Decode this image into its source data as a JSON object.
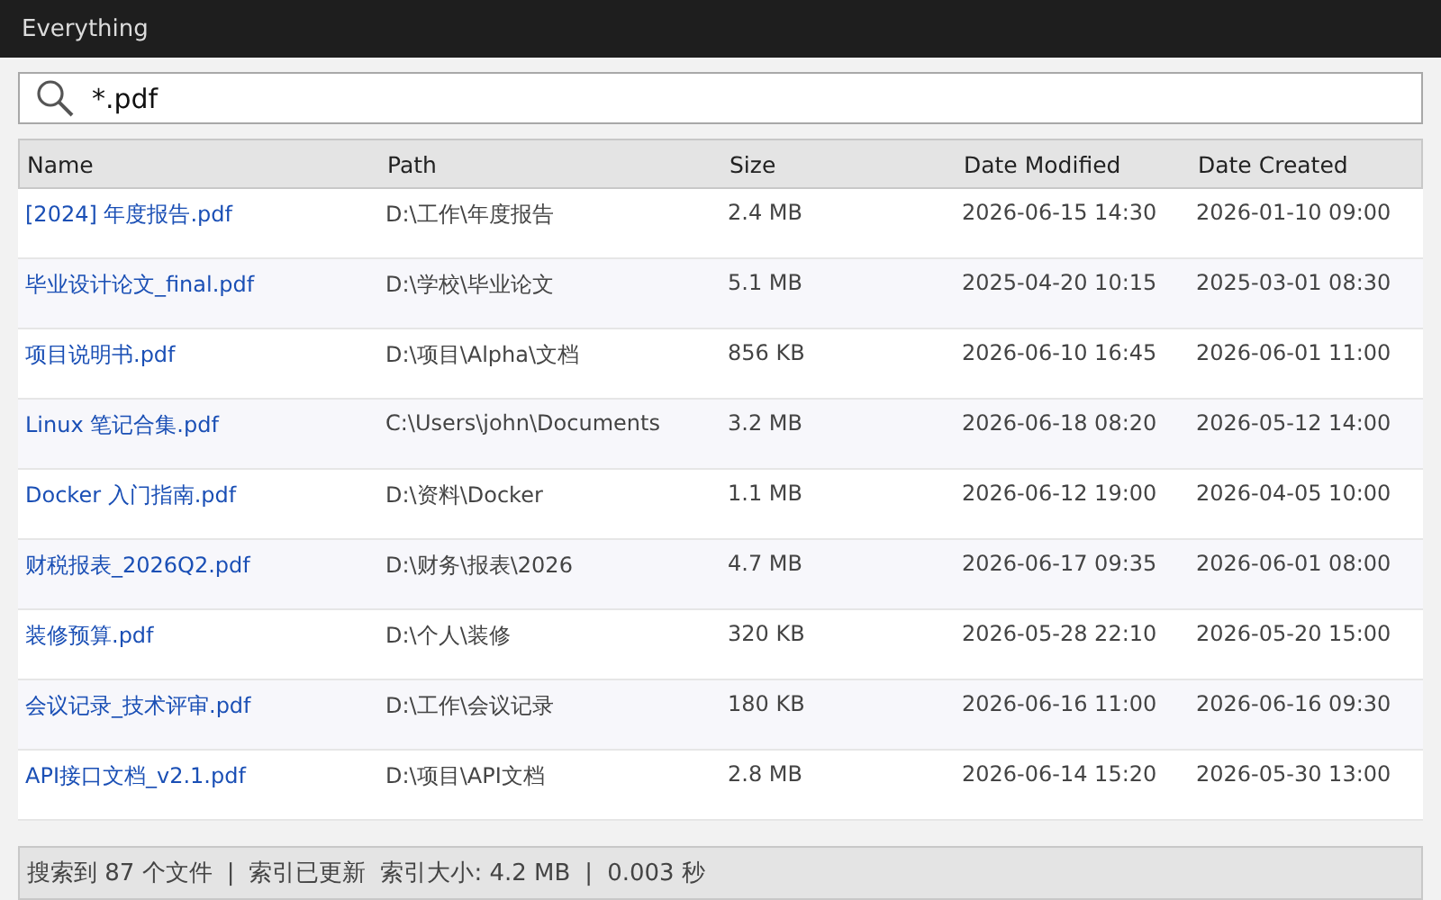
{
  "window": {
    "title": "Everything"
  },
  "search": {
    "value": "*.pdf"
  },
  "table": {
    "columns": [
      "Name",
      "Path",
      "Size",
      "Date Modified",
      "Date Created"
    ],
    "rows": [
      {
        "name": "[2024] 年度报告.pdf",
        "path": "D:\\工作\\年度报告",
        "size": "2.4 MB",
        "modified": "2026-06-15 14:30",
        "created": "2026-01-10 09:00"
      },
      {
        "name": "毕业设计论文_final.pdf",
        "path": "D:\\学校\\毕业论文",
        "size": "5.1 MB",
        "modified": "2025-04-20 10:15",
        "created": "2025-03-01 08:30"
      },
      {
        "name": "项目说明书.pdf",
        "path": "D:\\项目\\Alpha\\文档",
        "size": "856 KB",
        "modified": "2026-06-10 16:45",
        "created": "2026-06-01 11:00"
      },
      {
        "name": "Linux 笔记合集.pdf",
        "path": "C:\\Users\\john\\Documents",
        "size": "3.2 MB",
        "modified": "2026-06-18 08:20",
        "created": "2026-05-12 14:00"
      },
      {
        "name": "Docker 入门指南.pdf",
        "path": "D:\\资料\\Docker",
        "size": "1.1 MB",
        "modified": "2026-06-12 19:00",
        "created": "2026-04-05 10:00"
      },
      {
        "name": "财税报表_2026Q2.pdf",
        "path": "D:\\财务\\报表\\2026",
        "size": "4.7 MB",
        "modified": "2026-06-17 09:35",
        "created": "2026-06-01 08:00"
      },
      {
        "name": "装修预算.pdf",
        "path": "D:\\个人\\装修",
        "size": "320 KB",
        "modified": "2026-05-28 22:10",
        "created": "2026-05-20 15:00"
      },
      {
        "name": "会议记录_技术评审.pdf",
        "path": "D:\\工作\\会议记录",
        "size": "180 KB",
        "modified": "2026-06-16 11:00",
        "created": "2026-06-16 09:30"
      },
      {
        "name": "API接口文档_v2.1.pdf",
        "path": "D:\\项目\\API文档",
        "size": "2.8 MB",
        "modified": "2026-06-14 15:20",
        "created": "2026-05-30 13:00"
      }
    ]
  },
  "status_bar": [
    "搜索到 87 个文件",
    "|",
    "索引已更新",
    "索引大小: 4.2 MB",
    "|",
    "0.003 秒"
  ]
}
